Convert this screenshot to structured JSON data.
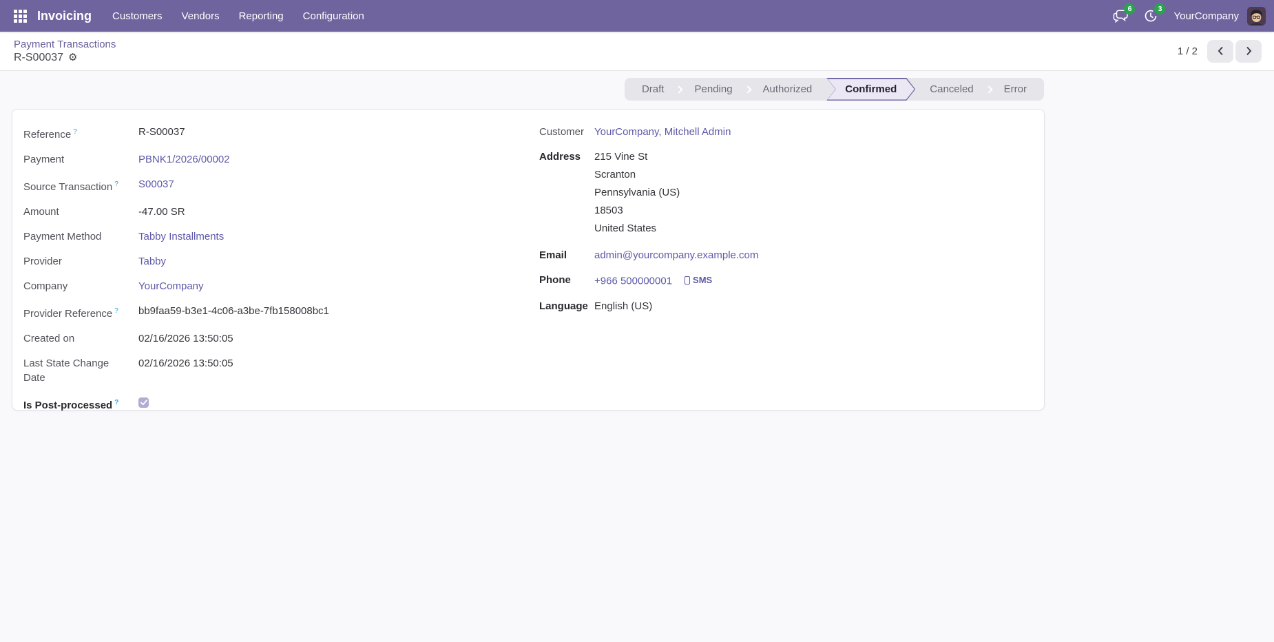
{
  "navbar": {
    "app_name": "Invoicing",
    "menu_items": [
      "Customers",
      "Vendors",
      "Reporting",
      "Configuration"
    ],
    "messages_badge": "6",
    "activities_badge": "3",
    "company_name": "YourCompany"
  },
  "breadcrumb": {
    "parent": "Payment Transactions",
    "current": "R-S00037"
  },
  "pager": {
    "counter": "1 / 2"
  },
  "statusbar": {
    "steps": [
      "Draft",
      "Pending",
      "Authorized",
      "Confirmed",
      "Canceled",
      "Error"
    ],
    "active_step": "Confirmed"
  },
  "form": {
    "left_fields": [
      {
        "label": "Reference",
        "help": true,
        "kind": "text",
        "value": "R-S00037"
      },
      {
        "label": "Payment",
        "help": false,
        "kind": "link",
        "value": "PBNK1/2026/00002"
      },
      {
        "label": "Source Transaction",
        "help": true,
        "kind": "link",
        "value": "S00037"
      },
      {
        "label": "Amount",
        "help": false,
        "kind": "text",
        "value": "-47.00 SR"
      },
      {
        "label": "Payment Method",
        "help": false,
        "kind": "link",
        "value": "Tabby Installments"
      },
      {
        "label": "Provider",
        "help": false,
        "kind": "link",
        "value": "Tabby"
      },
      {
        "label": "Company",
        "help": false,
        "kind": "link",
        "value": "YourCompany"
      },
      {
        "label": "Provider Reference",
        "help": true,
        "kind": "text",
        "value": "bb9faa59-b3e1-4c06-a3be-7fb158008bc1"
      },
      {
        "label": "Created on",
        "help": false,
        "kind": "text",
        "value": "02/16/2026 13:50:05"
      },
      {
        "label": "Last State Change Date",
        "help": false,
        "kind": "text",
        "value": "02/16/2026 13:50:05"
      },
      {
        "label": "Is Post-processed",
        "help": true,
        "bold": true,
        "kind": "checkbox",
        "checked": true
      }
    ],
    "right_fields": [
      {
        "label": "Customer",
        "bold": false,
        "kind": "link",
        "value": "YourCompany, Mitchell Admin"
      },
      {
        "label": "Address",
        "bold": true,
        "kind": "multiline",
        "lines": [
          "215 Vine St",
          "Scranton",
          "Pennsylvania (US)",
          "18503",
          "United States"
        ]
      },
      {
        "label": "Email",
        "bold": true,
        "kind": "link",
        "value": "admin@yourcompany.example.com"
      },
      {
        "label": "Phone",
        "bold": true,
        "kind": "link",
        "value": "+966 500000001",
        "suffix_button": "SMS"
      },
      {
        "label": "Language",
        "bold": true,
        "kind": "text",
        "value": "English (US)"
      }
    ]
  },
  "icons": {
    "apps_grid": "grid-3x3",
    "messages": "chat-bubbles",
    "activities": "clock",
    "settings": "gear",
    "pager_prev": "chevron-left",
    "pager_next": "chevron-right",
    "sms": "mobile-phone"
  },
  "colors": {
    "navbar_bg": "#6f649e",
    "link": "#5d59a8",
    "badge_green": "#26a54b",
    "active_step_border": "#7568a6",
    "active_step_bg": "#ebe7f4",
    "help_marker": "#2fa8cc",
    "checkbox_checked_bg": "#b4abd3",
    "content_bg": "#f9f9fc"
  }
}
